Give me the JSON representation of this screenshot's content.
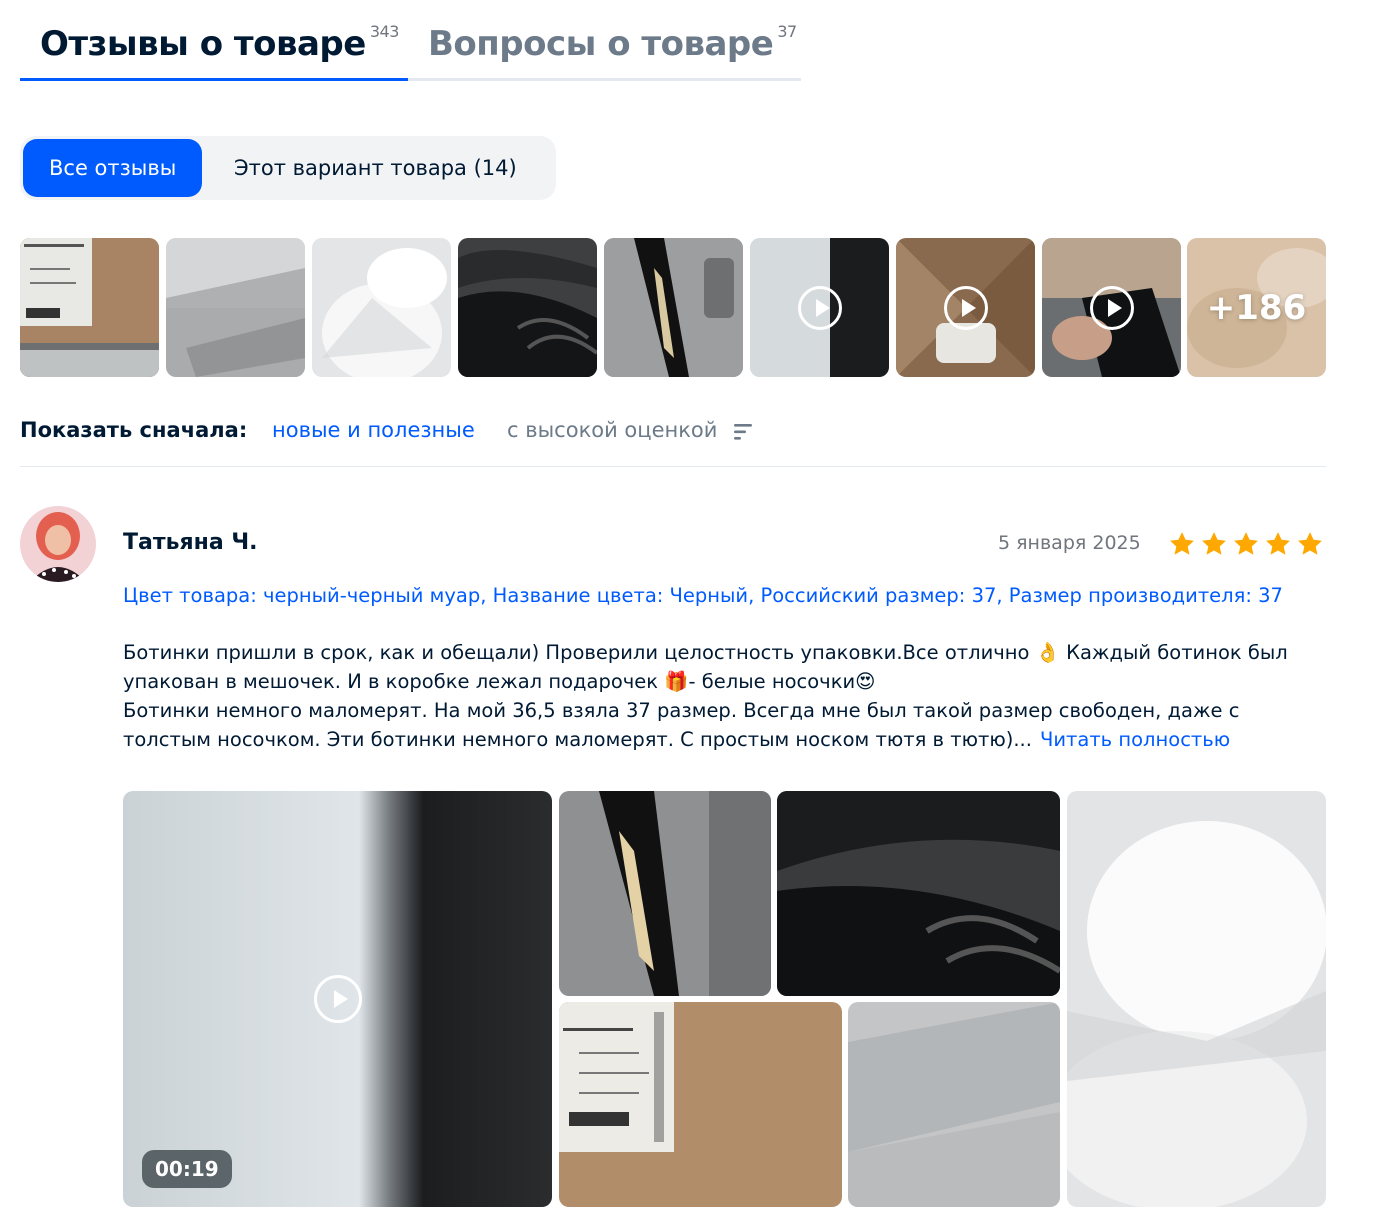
{
  "tabs": {
    "reviews": {
      "label": "Отзывы о товаре",
      "count": "343"
    },
    "questions": {
      "label": "Вопросы о товаре",
      "count": "37"
    }
  },
  "filters": {
    "all": "Все отзывы",
    "variant": "Этот вариант товара (14)"
  },
  "thumbnails": {
    "more_label": "+186"
  },
  "sort": {
    "label": "Показать сначала:",
    "option_new": "новые и полезные",
    "option_high": "с высокой оценкой",
    "icon": "sort-icon"
  },
  "review": {
    "author": "Татьяна Ч.",
    "date": "5 января 2025",
    "rating": 5,
    "variant": "Цвет товара: черный-черный муар, Название цвета: Черный, Российский размер: 37, Размер производителя: 37",
    "text_line1": "Ботинки пришли в срок, как и обещали) Проверили целостность упаковки.Все отлично 👌 Каждый ботинок был упакован в мешочек. И в коробке лежал подарочек 🎁- белые носочки😍",
    "text_line2": "Ботинки немного маломерят. На мой 36,5 взяла 37 размер. Всегда мне был такой размер свободен, даже с толстым носочком. Эти ботинки немного маломерят. С простым носком тютя в тютю)...",
    "read_more": "Читать полностью",
    "video_duration": "00:19"
  },
  "colors": {
    "accent": "#005bff",
    "star": "#ffa800",
    "text": "#001a34",
    "muted": "#70757e"
  }
}
